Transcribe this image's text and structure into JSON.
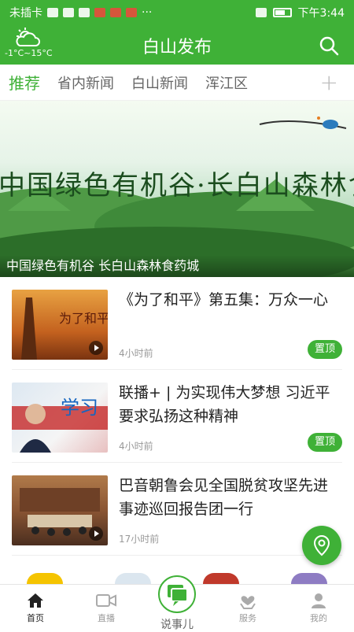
{
  "status": {
    "carrier": "未插卡",
    "time": "下午3:44"
  },
  "header": {
    "title": "白山发布",
    "weather_temp": "-1°C~15°C"
  },
  "tabs": [
    {
      "label": "推荐"
    },
    {
      "label": "省内新闻"
    },
    {
      "label": "白山新闻"
    },
    {
      "label": "浑江区"
    }
  ],
  "tab_add": "+",
  "banner": {
    "calligraphy": "中国绿色有机谷·长白山森林食药城",
    "caption": "中国绿色有机谷 长白山森林食药城"
  },
  "news": [
    {
      "title": "《为了和平》第五集：万众一心",
      "time": "4小时前",
      "badge": "置顶",
      "video": true,
      "thumb_text": "为了和平"
    },
    {
      "title": "联播+ | 为实现伟大梦想 习近平要求弘扬这种精神",
      "time": "4小时前",
      "badge": "置顶",
      "video": false,
      "thumb_text": "学习"
    },
    {
      "title": "巴音朝鲁会见全国脱贫攻坚先进事迹巡回报告团一行",
      "time": "17小时前",
      "badge": "",
      "video": true,
      "thumb_text": ""
    }
  ],
  "bottom_nav": {
    "home": "首页",
    "live": "直播",
    "talk": "说事儿",
    "service": "服务",
    "mine": "我的"
  },
  "colors": {
    "brand": "#3fb137",
    "text": "#222222",
    "muted": "#999999"
  }
}
